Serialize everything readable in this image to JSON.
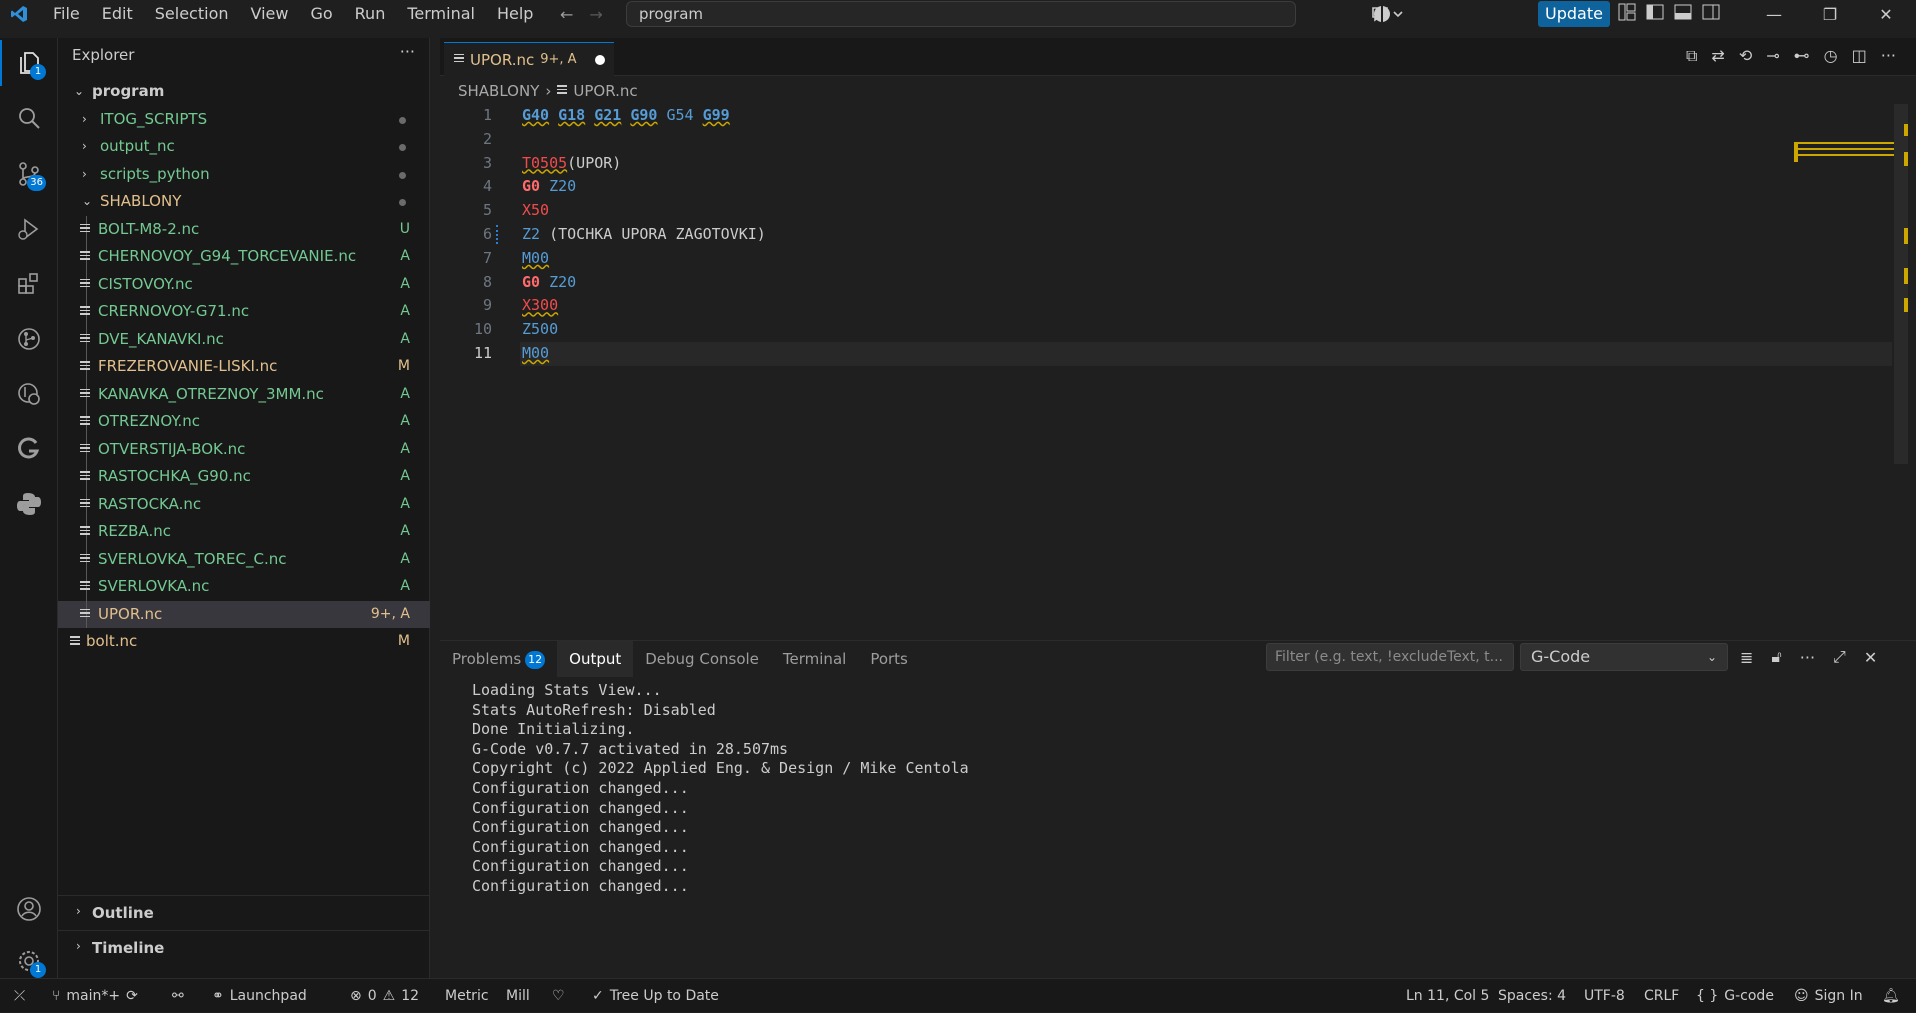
{
  "app": {
    "menu": [
      "File",
      "Edit",
      "Selection",
      "View",
      "Go",
      "Run",
      "Terminal",
      "Help"
    ],
    "search_text": "program",
    "update_label": "Update"
  },
  "activity_badges": {
    "explorer": "1",
    "scm": "36",
    "settings": "1"
  },
  "explorer": {
    "title": "Explorer",
    "root": "program",
    "items": [
      {
        "label": "ITOG_SCRIPTS",
        "type": "folder"
      },
      {
        "label": "output_nc",
        "type": "folder"
      },
      {
        "label": "scripts_python",
        "type": "folder"
      },
      {
        "label": "SHABLONY",
        "type": "folder-open"
      },
      {
        "label": "BOLT-M8-2.nc",
        "status": "U",
        "color": "#73c991"
      },
      {
        "label": "CHERNOVOY_G94_TORCEVANIE.nc",
        "status": "A",
        "color": "#73c991"
      },
      {
        "label": "CISTOVOY.nc",
        "status": "A",
        "color": "#73c991"
      },
      {
        "label": "CRERNOVOY-G71.nc",
        "status": "A",
        "color": "#73c991"
      },
      {
        "label": "DVE_KANAVKI.nc",
        "status": "A",
        "color": "#73c991"
      },
      {
        "label": "FREZEROVANIE-LISKI.nc",
        "status": "M",
        "color": "#e2c08d"
      },
      {
        "label": "KANAVKA_OTREZNOY_3MM.nc",
        "status": "A",
        "color": "#73c991"
      },
      {
        "label": "OTREZNOY.nc",
        "status": "A",
        "color": "#73c991"
      },
      {
        "label": "OTVERSTIJA-BOK.nc",
        "status": "A",
        "color": "#73c991"
      },
      {
        "label": "RASTOCHKA_G90.nc",
        "status": "A",
        "color": "#73c991"
      },
      {
        "label": "RASTOCKA.nc",
        "status": "A",
        "color": "#73c991"
      },
      {
        "label": "REZBA.nc",
        "status": "A",
        "color": "#73c991"
      },
      {
        "label": "SVERLOVKA_TOREC_C.nc",
        "status": "A",
        "color": "#73c991"
      },
      {
        "label": "SVERLOVKA.nc",
        "status": "A",
        "color": "#73c991"
      },
      {
        "label": "UPOR.nc",
        "status": "9+, A",
        "color": "#e2c08d"
      },
      {
        "label": "bolt.nc",
        "status": "M",
        "color": "#e2c08d"
      }
    ],
    "outline": "Outline",
    "timeline": "Timeline"
  },
  "editor": {
    "tab_name": "UPOR.nc",
    "tab_status": "9+, A",
    "breadcrumb": [
      "SHABLONY",
      "UPOR.nc"
    ]
  },
  "code_lines": [
    "1",
    "2",
    "3",
    "4",
    "5",
    "6",
    "7",
    "8",
    "9",
    "10",
    "11"
  ],
  "code_tokens": {
    "l1": [
      "G40",
      "G18",
      "G21",
      "G90",
      "G54",
      "G99"
    ],
    "l3a": "T0505",
    "l3b": "(UPOR)",
    "l4a": "G0",
    "l4b": "Z20",
    "l5": "X50",
    "l6a": "Z2",
    "l6b": " (TOCHKA UPORA ZAGOTOVKI)",
    "l7": "M00",
    "l8a": "G0",
    "l8b": "Z20",
    "l9": "X300",
    "l10": "Z500",
    "l11": "M00"
  },
  "panel": {
    "tabs": [
      "Problems",
      "Output",
      "Debug Console",
      "Terminal",
      "Ports"
    ],
    "problems_count": "12",
    "filter_placeholder": "Filter (e.g. text, !excludeText, t...",
    "channel": "G-Code",
    "output": [
      "Loading Stats View...",
      "Stats AutoRefresh: Disabled",
      "Done Initializing.",
      "G-Code v0.7.7 activated in 28.507ms",
      "Copyright (c) 2022 Applied Eng. & Design / Mike Centola",
      "Configuration changed...",
      "Configuration changed...",
      "Configuration changed...",
      "Configuration changed...",
      "Configuration changed...",
      "Configuration changed..."
    ]
  },
  "status": {
    "branch": "main*+",
    "launchpad": "Launchpad",
    "errors": "0",
    "warnings": "12",
    "metric": "Metric",
    "mill": "Mill",
    "tree": "Tree Up to Date",
    "position": "Ln 11, Col 5",
    "spaces": "Spaces: 4",
    "encoding": "UTF-8",
    "eol": "CRLF",
    "language": "G-code",
    "signin": "Sign In"
  }
}
